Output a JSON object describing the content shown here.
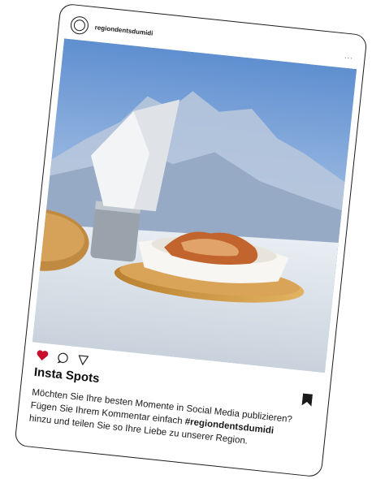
{
  "post": {
    "username": "regiondentsdumidi",
    "more_label": "...",
    "title": "Insta Spots",
    "caption_line1": "Möchten Sie Ihre besten Momente in Social Media publizieren?",
    "caption_line2_prefix": "Fügen Sie Ihrem Kommentar einfach ",
    "hashtag": "#regiondentsdumidi",
    "caption_line3": "hinzu und teilen Sie so Ihre Liebe zu unserer Region."
  },
  "icons": {
    "like": "heart-icon",
    "comment": "comment-icon",
    "share": "send-icon",
    "save": "bookmark-icon"
  },
  "colors": {
    "like_red": "#c8102e",
    "ink": "#1a1a1a"
  }
}
